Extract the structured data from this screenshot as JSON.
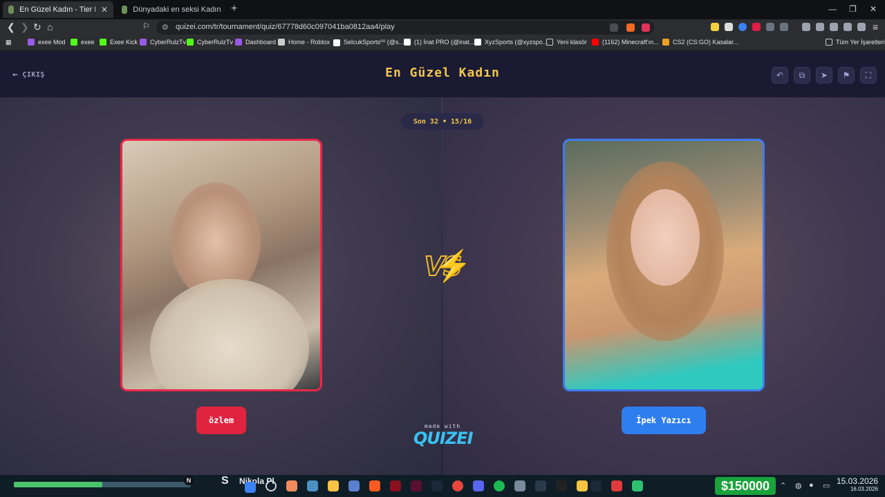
{
  "browser": {
    "tabs": [
      {
        "title": "En Güzel Kadın - Tier List, Kör Sı",
        "active": true
      },
      {
        "title": "Dünyadaki en seksi Kadın kim - Tier L",
        "active": false
      }
    ],
    "url": "quizei.com/tr/tournament/quiz/67778d60c097041ba0812aa4/play",
    "bookmarks": [
      {
        "label": "exee Mod",
        "color": "#9b59e6"
      },
      {
        "label": "exee",
        "color": "#9b59e6"
      },
      {
        "label": "Exee Kick",
        "color": "#53fc18"
      },
      {
        "label": "CyberRulzTv",
        "color": "#9b59e6"
      },
      {
        "label": "CyberRulzTv",
        "color": "#53fc18"
      },
      {
        "label": "Dashboard",
        "color": "#9b59e6"
      },
      {
        "label": "Home - Roblox",
        "color": "#cccccc"
      },
      {
        "label": "SelcukSports⁰⁰ (@s...",
        "color": "#ffffff"
      },
      {
        "label": "(1) İnat PRO (@inat...",
        "color": "#ffffff"
      },
      {
        "label": "XyzSports (@xyzspo...",
        "color": "#ffffff"
      },
      {
        "label": "Yeni klasör",
        "color": "#2b2d31"
      },
      {
        "label": "(1162) Minecraft'ın...",
        "color": "#ff0000"
      },
      {
        "label": "CS2 (CS:GO) Kasalar...",
        "color": "#f0a020"
      }
    ],
    "all_bookmarks": "Tüm Yer İşaretleri"
  },
  "header": {
    "exit_label": "ÇIKIŞ",
    "title": "En Güzel Kadın",
    "buttons": [
      "undo-icon",
      "share-icon",
      "send-icon",
      "flag-icon",
      "fullscreen-icon"
    ]
  },
  "round": {
    "label": "Son 32 • 15/16"
  },
  "left": {
    "name": "özlem",
    "accent": "#e8294a"
  },
  "right": {
    "name": "İpek Yazıcı",
    "accent": "#3f7cf0"
  },
  "vs_label": "VS",
  "footer": {
    "made_with": "made with",
    "logo": "QUIZEI"
  },
  "taskbar": {
    "progress": 0.5,
    "stream_letter": "S",
    "stream_name": "Nikola Pl",
    "money": "$150000",
    "time": "15.03.2026",
    "date": "16.03.2026"
  }
}
